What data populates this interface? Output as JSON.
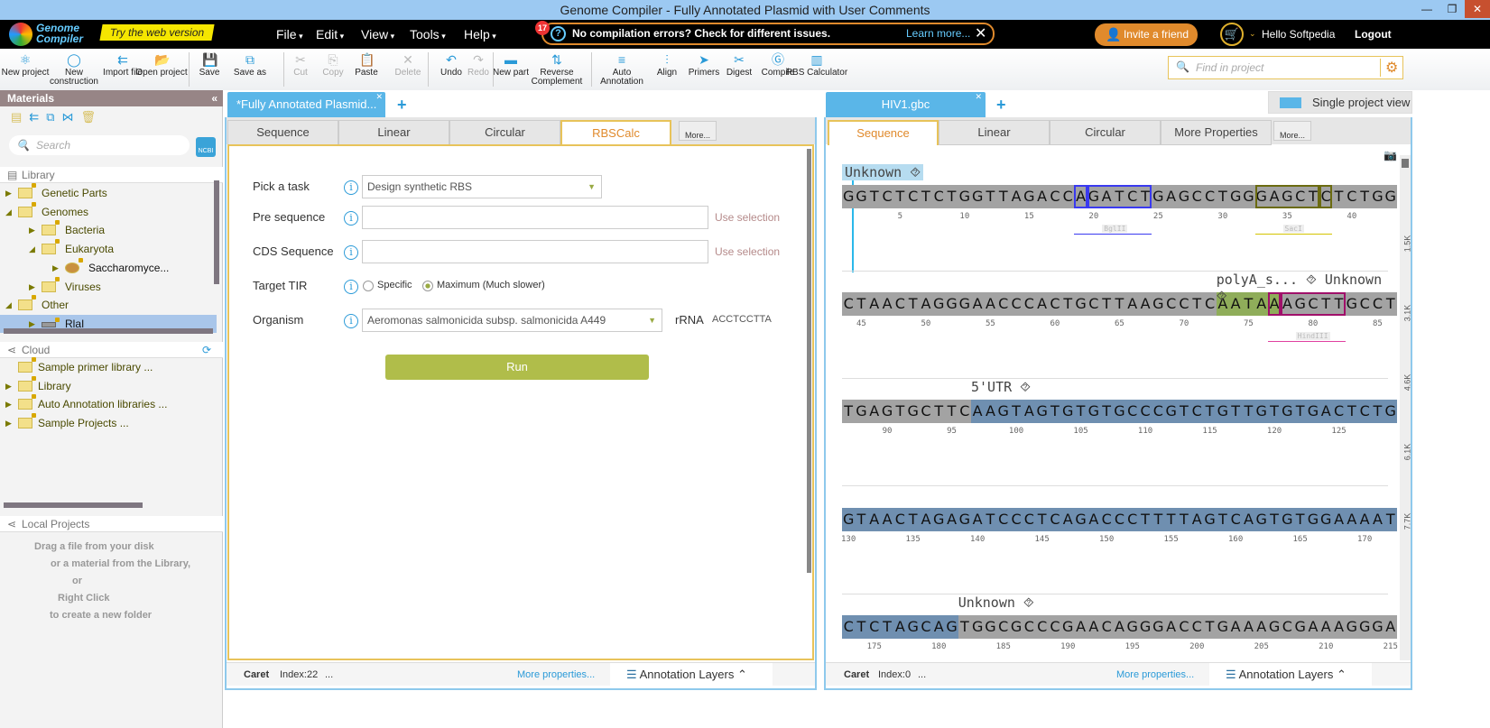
{
  "window": {
    "title": "Genome Compiler - Fully Annotated Plasmid with User Comments"
  },
  "header": {
    "logo": "Genome Compiler",
    "try_web": "Try the web version",
    "menus": [
      "File",
      "Edit",
      "View",
      "Tools",
      "Help"
    ],
    "notif_count": "17",
    "notif_text": "No compilation errors? Check for different issues.",
    "learn_more": "Learn more...",
    "invite": "Invite a friend",
    "hello": "Hello Softpedia",
    "logout": "Logout"
  },
  "toolbar": {
    "items": [
      "New project",
      "New construction",
      "Import file",
      "Open project",
      "Save",
      "Save as",
      "Cut",
      "Copy",
      "Paste",
      "Delete",
      "Undo",
      "Redo",
      "New part",
      "Reverse Complement",
      "Auto Annotation",
      "Align",
      "Primers",
      "Digest",
      "Compile",
      "RBS Calculator"
    ],
    "find_placeholder": "Find in project"
  },
  "sidebar": {
    "title": "Materials",
    "search_placeholder": "Search",
    "ncbi": "NCBI",
    "library_label": "Library",
    "library": [
      "Genetic Parts",
      "Genomes",
      "Bacteria",
      "Eukaryota",
      "Saccharomyce...",
      "Viruses",
      "Other",
      "RlaI"
    ],
    "cloud_label": "Cloud",
    "cloud": [
      "Sample primer library ...",
      "Library",
      "Auto Annotation libraries ...",
      "Sample Projects ..."
    ],
    "local_label": "Local Projects",
    "local_hint": [
      "Drag a file from your disk",
      "or a material from the Library,",
      "or",
      "Right Click",
      "to create a new folder"
    ]
  },
  "left": {
    "doc_tab": "*Fully Annotated Plasmid...",
    "tabs": [
      "Sequence",
      "Linear",
      "Circular",
      "RBSCalc"
    ],
    "more": "More...",
    "form": {
      "task_label": "Pick a task",
      "task_value": "Design synthetic RBS",
      "pre_label": "Pre sequence",
      "cds_label": "CDS Sequence",
      "use_selection": "Use selection",
      "tir_label": "Target TIR",
      "tir_specific": "Specific",
      "tir_max": "Maximum (Much slower)",
      "org_label": "Organism",
      "org_value": "Aeromonas salmonicida subsp. salmonicida A449",
      "rrna_label": "rRNA",
      "rrna_value": "ACCTCCTTA",
      "run": "Run"
    },
    "footer": {
      "caret": "Caret",
      "index": "Index:22",
      "dots": "...",
      "more_props": "More properties...",
      "layers": "Annotation Layers"
    }
  },
  "right": {
    "doc_tab": "HIV1.gbc",
    "single_view": "Single project view",
    "tabs": [
      "Sequence",
      "Linear",
      "Circular",
      "More Properties"
    ],
    "more": "More...",
    "footer": {
      "caret": "Caret",
      "index": "Index:0",
      "dots": "...",
      "more_props": "More properties...",
      "layers": "Annotation Layers"
    },
    "ruler": [
      "1.5K",
      "3.1K",
      "4.6K",
      "6.1K",
      "7.7K"
    ],
    "rows": [
      {
        "start": 1,
        "seq": "GGTCTCTCTGGTTAGACCAGATCTGAGCCTGGGAGCTCTCTGG",
        "segs": [
          [
            0,
            43,
            "#a3a3a3"
          ]
        ],
        "boxes": [
          [
            18,
            19,
            "#3a3af0"
          ],
          [
            19,
            24,
            "#3a3af0"
          ],
          [
            32,
            37,
            "#6b6b10"
          ],
          [
            37,
            38,
            "#6b6b10"
          ]
        ],
        "labels": [
          {
            "text": "Unknown ⯑",
            "at": 0,
            "hl": true
          }
        ],
        "enz": [
          {
            "name": "BglII",
            "from": 18,
            "to": 24,
            "color": "#3a3af0"
          },
          {
            "name": "SacI",
            "from": 32,
            "to": 38,
            "color": "#d4c400"
          }
        ]
      },
      {
        "start": 44,
        "seq": "CTAACTAGGGAACCCACTGCTTAAGCCTCAATAAAGCTTGCCT",
        "segs": [
          [
            0,
            29,
            "#a3a3a3"
          ],
          [
            29,
            34,
            "#8fad5a"
          ],
          [
            34,
            43,
            "#a3a3a3"
          ]
        ],
        "boxes": [
          [
            33,
            34,
            "#a0106a"
          ],
          [
            34,
            39,
            "#a0106a"
          ]
        ],
        "labels": [
          {
            "text": "polyA_s... ⯑ Unknown ⯑",
            "at": 29,
            "hl": false
          }
        ],
        "enz": [
          {
            "name": "HindIII",
            "from": 33,
            "to": 39,
            "color": "#e040a0"
          }
        ]
      },
      {
        "start": 87,
        "seq": "TGAGTGCTTCAAGTAGTGTGTGCCCGTCTGTTGTGTGACTCTG",
        "segs": [
          [
            0,
            10,
            "#a3a3a3"
          ],
          [
            10,
            43,
            "#6f8fb0"
          ]
        ],
        "boxes": [],
        "labels": [
          {
            "text": "5'UTR ⯑",
            "at": 10,
            "hl": false
          }
        ],
        "enz": []
      },
      {
        "start": 130,
        "seq": "GTAACTAGAGATCCCTCAGACCCTTTTAGTCAGTGTGGAAAAT",
        "segs": [
          [
            0,
            43,
            "#6f8fb0"
          ]
        ],
        "boxes": [],
        "labels": [],
        "enz": []
      },
      {
        "start": 173,
        "seq": "CTCTAGCAGTGGCGCCCGAACAGGGACCTGAAAGCGAAAGGGA",
        "segs": [
          [
            0,
            9,
            "#6f8fb0"
          ],
          [
            9,
            43,
            "#a3a3a3"
          ]
        ],
        "boxes": [],
        "labels": [
          {
            "text": "Unknown ⯑",
            "at": 9,
            "hl": false
          }
        ],
        "enz": []
      }
    ]
  }
}
